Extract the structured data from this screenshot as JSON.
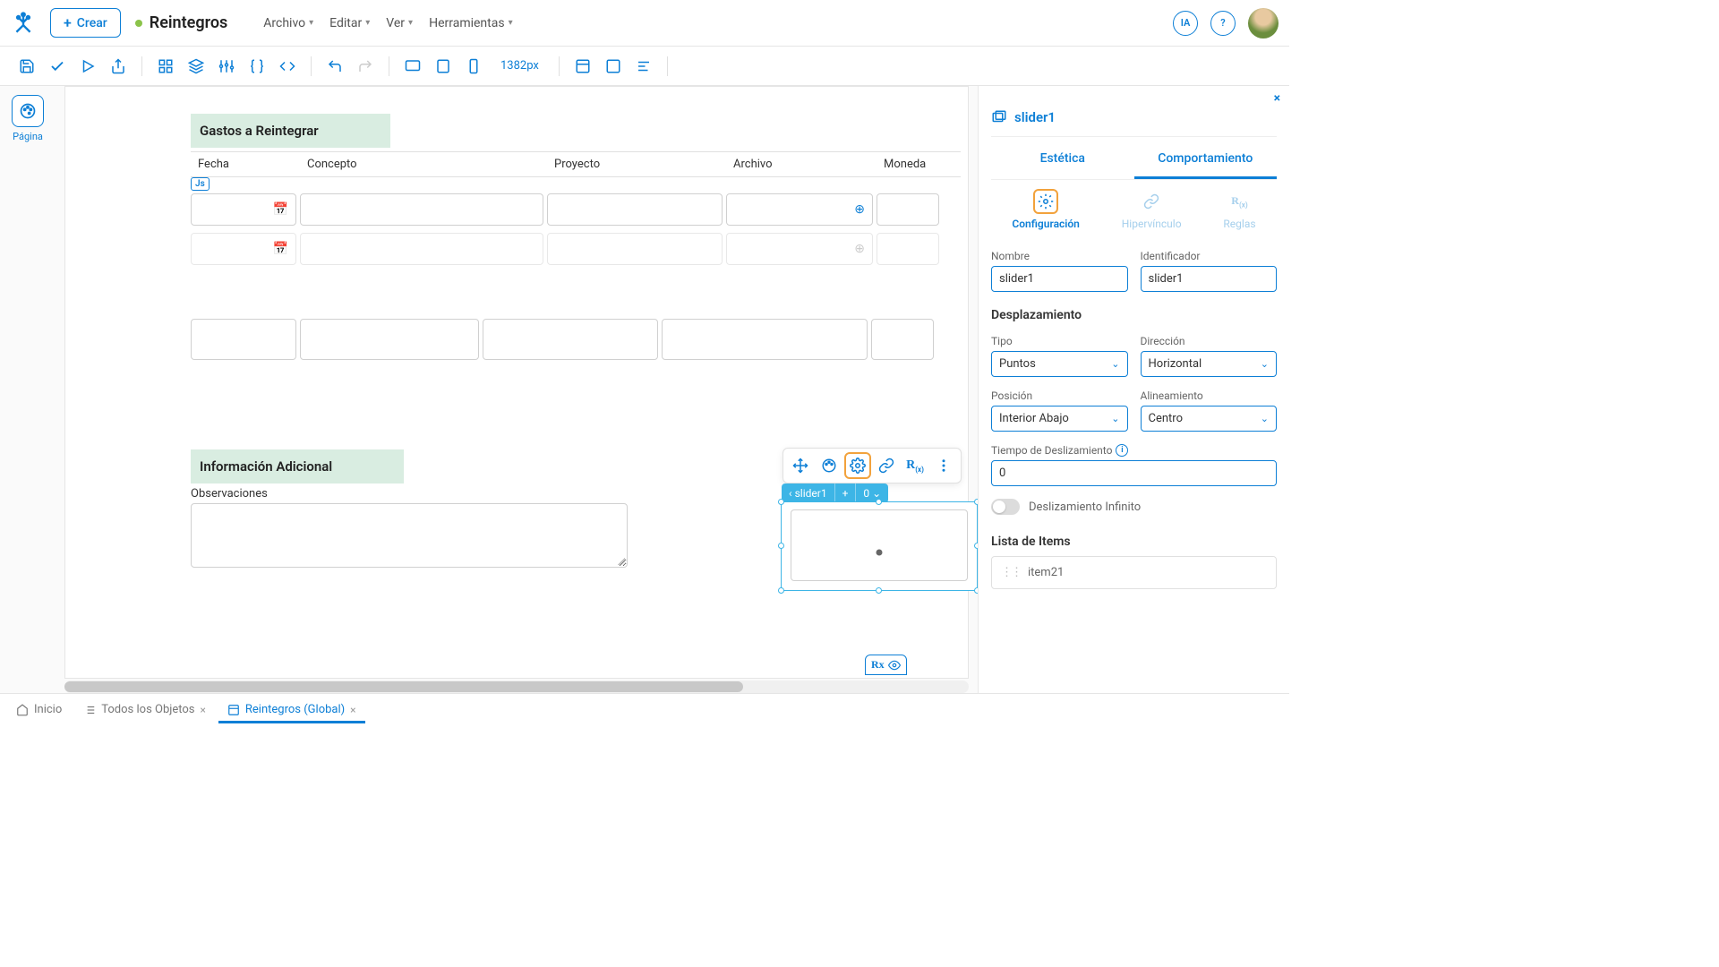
{
  "header": {
    "create_label": "Crear",
    "doc_title": "Reintegros",
    "menus": [
      "Archivo",
      "Editar",
      "Ver",
      "Herramientas"
    ]
  },
  "toolbar": {
    "zoom": "1382px"
  },
  "left_rail": {
    "page_label": "Página"
  },
  "canvas": {
    "section1_title": "Gastos a Reintegrar",
    "headers": [
      "Fecha",
      "Concepto",
      "Proyecto",
      "Archivo",
      "Moneda"
    ],
    "js_badge": "Js",
    "section2_title": "Información Adicional",
    "obs_label": "Observaciones",
    "selection_tag": {
      "name": "slider1",
      "plus": "+",
      "count": "0"
    },
    "rx_label": "Rx"
  },
  "panel": {
    "title": "slider1",
    "tabs": {
      "estetica": "Estética",
      "comportamiento": "Comportamiento"
    },
    "subtabs": {
      "config": "Configuración",
      "hyperlink": "Hipervínculo",
      "rules": "Reglas"
    },
    "fields": {
      "nombre_label": "Nombre",
      "nombre_value": "slider1",
      "ident_label": "Identificador",
      "ident_value": "slider1",
      "desplaz_heading": "Desplazamiento",
      "tipo_label": "Tipo",
      "tipo_value": "Puntos",
      "dir_label": "Dirección",
      "dir_value": "Horizontal",
      "pos_label": "Posición",
      "pos_value": "Interior Abajo",
      "align_label": "Alineamiento",
      "align_value": "Centro",
      "tiempo_label": "Tiempo de Deslizamiento",
      "tiempo_value": "0",
      "infinite_label": "Deslizamiento Infinito",
      "items_heading": "Lista de Items",
      "item1": "item21"
    }
  },
  "bottom_tabs": {
    "inicio": "Inicio",
    "todos": "Todos los Objetos",
    "reintegros": "Reintegros (Global)"
  }
}
